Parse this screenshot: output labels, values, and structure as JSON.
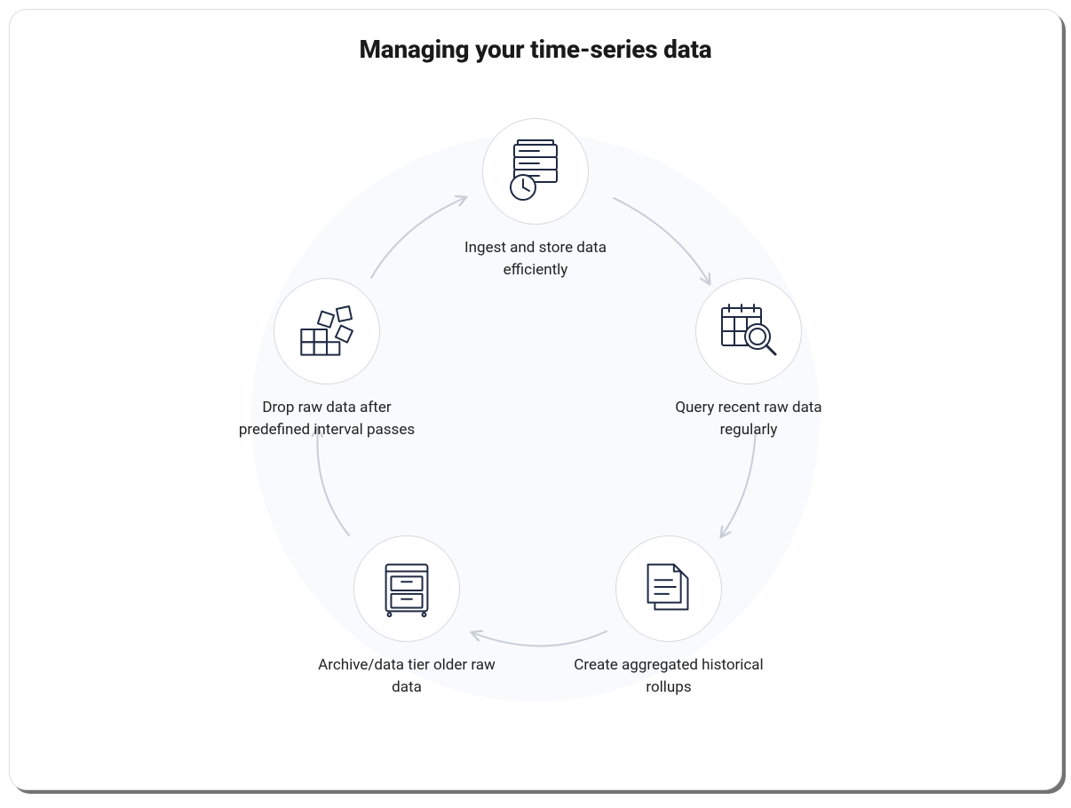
{
  "title": "Managing your time-series data",
  "cycle": {
    "steps": [
      {
        "id": "ingest",
        "label": "Ingest and store data efficiently"
      },
      {
        "id": "query",
        "label": "Query recent raw data regularly"
      },
      {
        "id": "rollup",
        "label": "Create aggregated historical rollups"
      },
      {
        "id": "archive",
        "label": "Archive/data tier older raw data"
      },
      {
        "id": "drop",
        "label": "Drop raw data after predefined interval passes"
      }
    ]
  },
  "colors": {
    "icon_stroke": "#1f2a44",
    "arrow_stroke": "#c9cdd6",
    "circle_border": "#d7d9de",
    "bg_tint": "#F8FAFD"
  }
}
